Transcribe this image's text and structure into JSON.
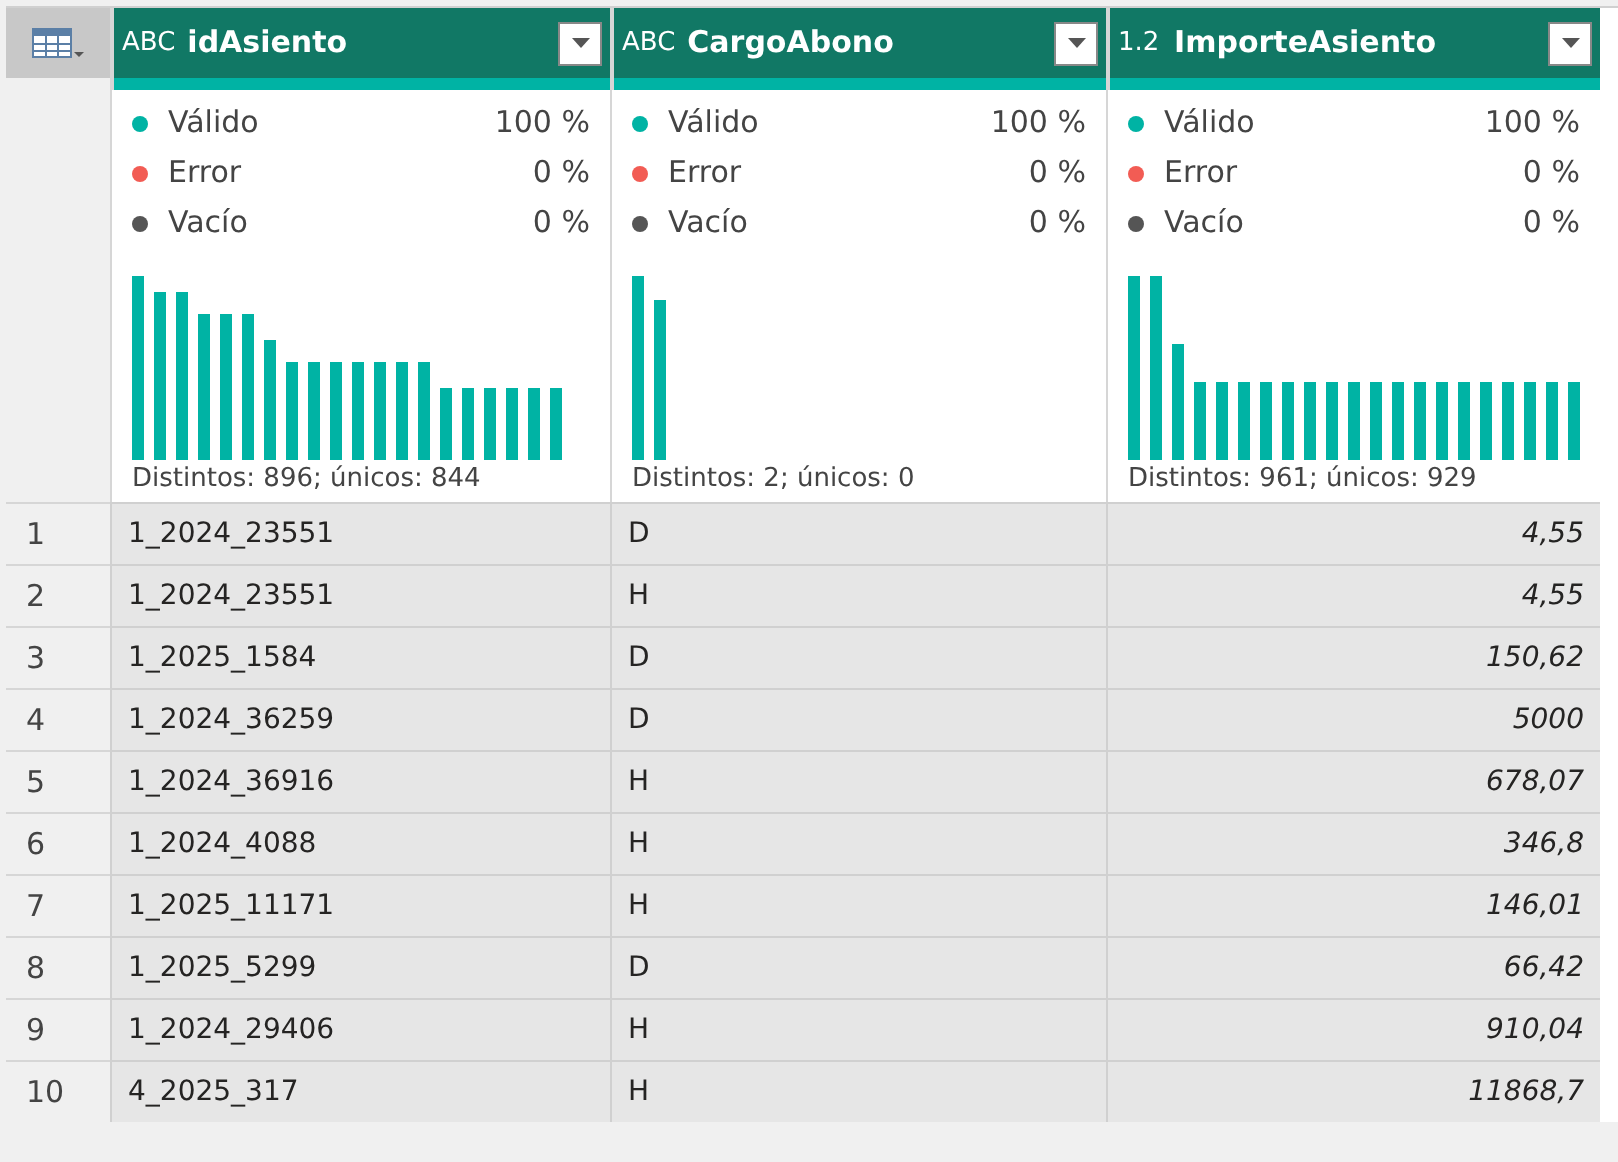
{
  "columns": [
    {
      "type_label": "ABC",
      "name": "idAsiento",
      "quality": [
        {
          "label": "Válido",
          "value": "100 %",
          "color": "#00b3a4"
        },
        {
          "label": "Error",
          "value": "0 %",
          "color": "#f25c54"
        },
        {
          "label": "Vacío",
          "value": "0 %",
          "color": "#555555"
        }
      ],
      "summary": "Distintos: 896; únicos: 844",
      "kind": "text"
    },
    {
      "type_label": "ABC",
      "name": "CargoAbono",
      "quality": [
        {
          "label": "Válido",
          "value": "100 %",
          "color": "#00b3a4"
        },
        {
          "label": "Error",
          "value": "0 %",
          "color": "#f25c54"
        },
        {
          "label": "Vacío",
          "value": "0 %",
          "color": "#555555"
        }
      ],
      "summary": "Distintos: 2; únicos: 0",
      "kind": "text"
    },
    {
      "type_label": "1.2",
      "name": "ImporteAsiento",
      "quality": [
        {
          "label": "Válido",
          "value": "100 %",
          "color": "#00b3a4"
        },
        {
          "label": "Error",
          "value": "0 %",
          "color": "#f25c54"
        },
        {
          "label": "Vacío",
          "value": "0 %",
          "color": "#555555"
        }
      ],
      "summary": "Distintos: 961; únicos: 929",
      "kind": "number"
    }
  ],
  "rows": [
    {
      "number": "1",
      "cells": [
        "1_2024_23551",
        "D",
        "4,55"
      ]
    },
    {
      "number": "2",
      "cells": [
        "1_2024_23551",
        "H",
        "4,55"
      ]
    },
    {
      "number": "3",
      "cells": [
        "1_2025_1584",
        "D",
        "150,62"
      ]
    },
    {
      "number": "4",
      "cells": [
        "1_2024_36259",
        "D",
        "5000"
      ]
    },
    {
      "number": "5",
      "cells": [
        "1_2024_36916",
        "H",
        "678,07"
      ]
    },
    {
      "number": "6",
      "cells": [
        "1_2024_4088",
        "H",
        "346,8"
      ]
    },
    {
      "number": "7",
      "cells": [
        "1_2025_11171",
        "H",
        "146,01"
      ]
    },
    {
      "number": "8",
      "cells": [
        "1_2025_5299",
        "D",
        "66,42"
      ]
    },
    {
      "number": "9",
      "cells": [
        "1_2024_29406",
        "H",
        "910,04"
      ]
    },
    {
      "number": "10",
      "cells": [
        "4_2025_317",
        "H",
        "11868,7"
      ]
    }
  ]
}
